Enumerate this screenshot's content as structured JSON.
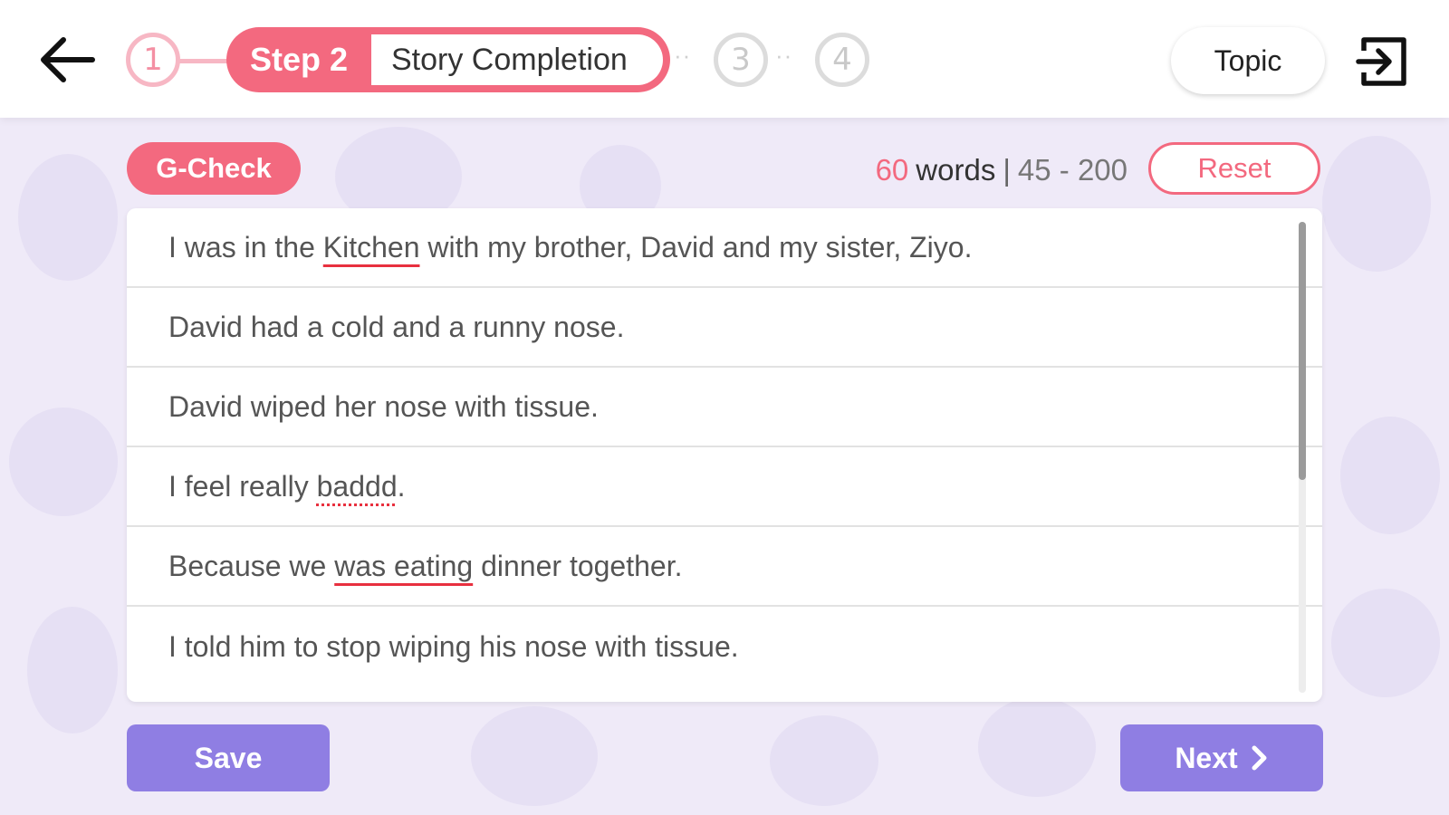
{
  "header": {
    "steps": {
      "done_number": "1",
      "current_number": "Step 2",
      "current_name": "Story Completion",
      "next_numbers": [
        "3",
        "4"
      ]
    },
    "topic_label": "Topic"
  },
  "toolbar": {
    "gcheck_label": "G-Check",
    "word_count": "60",
    "word_label": "words",
    "separator": "|",
    "range": "45 - 200",
    "reset_label": "Reset"
  },
  "sentences": [
    {
      "pre": "I was in the ",
      "err": "Kitchen",
      "post": " with my brother, David and my sister, Ziyo."
    },
    {
      "pre": "David had a cold and a runny nose.",
      "err": "",
      "post": ""
    },
    {
      "pre": "David wiped her nose with tissue.",
      "err": "",
      "post": ""
    },
    {
      "pre": "I feel really ",
      "err": "baddd",
      "post": "."
    },
    {
      "pre": "Because we ",
      "err": "was eating",
      "post": " dinner together."
    },
    {
      "pre": "I told him to stop wiping his nose with tissue.",
      "err": "",
      "post": ""
    }
  ],
  "footer": {
    "save_label": "Save",
    "next_label": "Next"
  },
  "colors": {
    "accent_pink": "#f3697f",
    "accent_purple": "#8f7ee3",
    "error_red": "#e8303f"
  },
  "icons": [
    "back-arrow-icon",
    "exit-icon",
    "chevron-right-icon"
  ]
}
